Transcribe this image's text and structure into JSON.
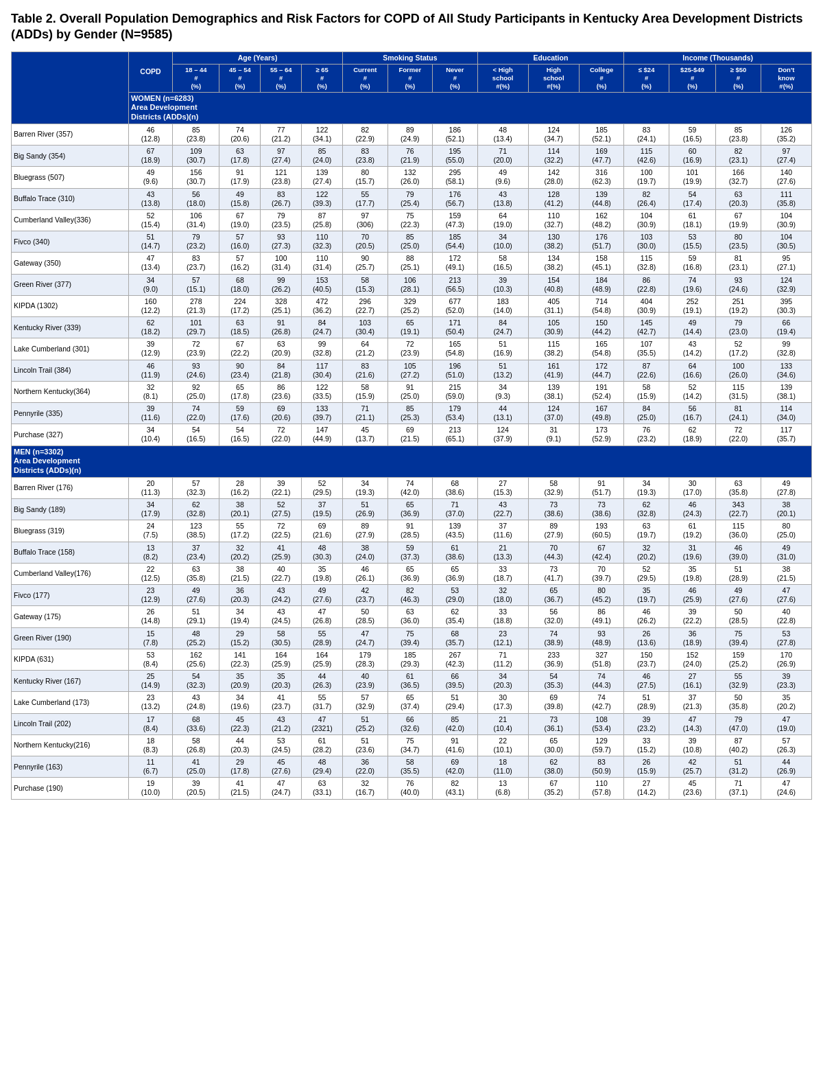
{
  "title": "Table 2.   Overall Population Demographics and Risk Factors for COPD of All Study Participants in Kentucky Area Development Districts (ADDs) by Gender (N=9585)",
  "headers": {
    "col1": "",
    "copd": "COPD",
    "age": "Age (Years)",
    "smoking": "Smoking Status",
    "education": "Education",
    "income": "Income (Thousands)"
  },
  "subheaders": {
    "col1_label": "WOMEN (n=6283)\nArea Development\nDistricts (ADDs)(n)",
    "copd_sub": "# (%)",
    "age1": "18 – 44 #  (%)",
    "age2": "45 – 54 # (%)",
    "age3": "55 – 64 # (%)",
    "age4": "≥ 65 # (%)",
    "sm1": "Current # (%)",
    "sm2": "Former # (%)",
    "sm3": "Never # (%)",
    "ed1": "< High school # #(%)",
    "ed2": "High school #(%)",
    "ed3": "College # (%)",
    "inc1": "≤ $24 # (%)",
    "inc2": "$25-$49 # (%)",
    "inc3": "≥ $50 # (%)",
    "inc4": "Don't know #(%)"
  },
  "women_rows": [
    {
      "name": "Barren River (357)",
      "copd": "46\n(12.8)",
      "a1": "85\n(23.8)",
      "a2": "74\n(20.6)",
      "a3": "77\n(21.2)",
      "a4": "122\n(34.1)",
      "s1": "82\n(22.9)",
      "s2": "89\n(24.9)",
      "s3": "186\n(52.1)",
      "e1": "48\n(13.4)",
      "e2": "124\n(34.7)",
      "e3": "185\n(52.1)",
      "i1": "83\n(24.1)",
      "i2": "59\n(16.5)",
      "i3": "85\n(23.8)",
      "i4": "126\n(35.2)"
    },
    {
      "name": "Big Sandy (354)",
      "copd": "67\n(18.9)",
      "a1": "109\n(30.7)",
      "a2": "63\n(17.8)",
      "a3": "97\n(27.4)",
      "a4": "85\n(24.0)",
      "s1": "83\n(23.8)",
      "s2": "76\n(21.9)",
      "s3": "195\n(55.0)",
      "e1": "71\n(20.0)",
      "e2": "114\n(32.2)",
      "e3": "169\n(47.7)",
      "i1": "115\n(42.6)",
      "i2": "60\n(16.9)",
      "i3": "82\n(23.1)",
      "i4": "97\n(27.4)"
    },
    {
      "name": "Bluegrass (507)",
      "copd": "49\n(9.6)",
      "a1": "156\n(30.7)",
      "a2": "91\n(17.9)",
      "a3": "121\n(23.8)",
      "a4": "139\n(27.4)",
      "s1": "80\n(15.7)",
      "s2": "132\n(26.0)",
      "s3": "295\n(58.1)",
      "e1": "49\n(9.6)",
      "e2": "142\n(28.0)",
      "e3": "316\n(62.3)",
      "i1": "100\n(19.7)",
      "i2": "101\n(19.9)",
      "i3": "166\n(32.7)",
      "i4": "140\n(27.6)"
    },
    {
      "name": "Buffalo Trace (310)",
      "copd": "43\n(13.8)",
      "a1": "56\n(18.0)",
      "a2": "49\n(15.8)",
      "a3": "83\n(26.7)",
      "a4": "122\n(39.3)",
      "s1": "55\n(17.7)",
      "s2": "79\n(25.4)",
      "s3": "176\n(56.7)",
      "e1": "43\n(13.8)",
      "e2": "128\n(41.2)",
      "e3": "139\n(44.8)",
      "i1": "82\n(26.4)",
      "i2": "54\n(17.4)",
      "i3": "63\n(20.3)",
      "i4": "111\n(35.8)"
    },
    {
      "name": "Cumberland Valley(336)",
      "copd": "52\n(15.4)",
      "a1": "106\n(31.4)",
      "a2": "67\n(19.0)",
      "a3": "79\n(23.5)",
      "a4": "87\n(25.8)",
      "s1": "97\n(306)",
      "s2": "75\n(22.3)",
      "s3": "159\n(47.3)",
      "e1": "64\n(19.0)",
      "e2": "110\n(32.7)",
      "e3": "162\n(48.2)",
      "i1": "104\n(30.9)",
      "i2": "61\n(18.1)",
      "i3": "67\n(19.9)",
      "i4": "104\n(30.9)"
    },
    {
      "name": "Fivco (340)",
      "copd": "51\n(14.7)",
      "a1": "79\n(23.2)",
      "a2": "57\n(16.0)",
      "a3": "93\n(27.3)",
      "a4": "110\n(32.3)",
      "s1": "70\n(20.5)",
      "s2": "85\n(25.0)",
      "s3": "185\n(54.4)",
      "e1": "34\n(10.0)",
      "e2": "130\n(38.2)",
      "e3": "176\n(51.7)",
      "i1": "103\n(30.0)",
      "i2": "53\n(15.5)",
      "i3": "80\n(23.5)",
      "i4": "104\n(30.5)"
    },
    {
      "name": "Gateway (350)",
      "copd": "47\n(13.4)",
      "a1": "83\n(23.7)",
      "a2": "57\n(16.2)",
      "a3": "100\n(31.4)",
      "a4": "110\n(31.4)",
      "s1": "90\n(25.7)",
      "s2": "88\n(25.1)",
      "s3": "172\n(49.1)",
      "e1": "58\n(16.5)",
      "e2": "134\n(38.2)",
      "e3": "158\n(45.1)",
      "i1": "115\n(32.8)",
      "i2": "59\n(16.8)",
      "i3": "81\n(23.1)",
      "i4": "95\n(27.1)"
    },
    {
      "name": "Green River (377)",
      "copd": "34\n(9.0)",
      "a1": "57\n(15.1)",
      "a2": "68\n(18.0)",
      "a3": "99\n(26.2)",
      "a4": "153\n(40.5)",
      "s1": "58\n(15.3)",
      "s2": "106\n(28.1)",
      "s3": "213\n(56.5)",
      "e1": "39\n(10.3)",
      "e2": "154\n(40.8)",
      "e3": "184\n(48.9)",
      "i1": "86\n(22.8)",
      "i2": "74\n(19.6)",
      "i3": "93\n(24.6)",
      "i4": "124\n(32.9)"
    },
    {
      "name": "KIPDA (1302)",
      "copd": "160\n(12.2)",
      "a1": "278\n(21.3)",
      "a2": "224\n(17.2)",
      "a3": "328\n(25.1)",
      "a4": "472\n(36.2)",
      "s1": "296\n(22.7)",
      "s2": "329\n(25.2)",
      "s3": "677\n(52.0)",
      "e1": "183\n(14.0)",
      "e2": "405\n(31.1)",
      "e3": "714\n(54.8)",
      "i1": "404\n(30.9)",
      "i2": "252\n(19.1)",
      "i3": "251\n(19.2)",
      "i4": "395\n(30.3)"
    },
    {
      "name": "Kentucky River (339)",
      "copd": "62\n(18.2)",
      "a1": "101\n(29.7)",
      "a2": "63\n(18.5)",
      "a3": "91\n(26.8)",
      "a4": "84\n(24.7)",
      "s1": "103\n(30.4)",
      "s2": "65\n(19.1)",
      "s3": "171\n(50.4)",
      "e1": "84\n(24.7)",
      "e2": "105\n(30.9)",
      "e3": "150\n(44.2)",
      "i1": "145\n(42.7)",
      "i2": "49\n(14.4)",
      "i3": "79\n(23.0)",
      "i4": "66\n(19.4)"
    },
    {
      "name": "Lake Cumberland (301)",
      "copd": "39\n(12.9)",
      "a1": "72\n(23.9)",
      "a2": "67\n(22.2)",
      "a3": "63\n(20.9)",
      "a4": "99\n(32.8)",
      "s1": "64\n(21.2)",
      "s2": "72\n(23.9)",
      "s3": "165\n(54.8)",
      "e1": "51\n(16.9)",
      "e2": "115\n(38.2)",
      "e3": "165\n(54.8)",
      "i1": "107\n(35.5)",
      "i2": "43\n(14.2)",
      "i3": "52\n(17.2)",
      "i4": "99\n(32.8)"
    },
    {
      "name": "Lincoln Trail (384)",
      "copd": "46\n(11.9)",
      "a1": "93\n(24.6)",
      "a2": "90\n(23.4)",
      "a3": "84\n(21.8)",
      "a4": "117\n(30.4)",
      "s1": "83\n(21.6)",
      "s2": "105\n(27.2)",
      "s3": "196\n(51.0)",
      "e1": "51\n(13.2)",
      "e2": "161\n(41.9)",
      "e3": "172\n(44.7)",
      "i1": "87\n(22.6)",
      "i2": "64\n(16.6)",
      "i3": "100\n(26.0)",
      "i4": "133\n(34.6)"
    },
    {
      "name": "Northern Kentucky(364)",
      "copd": "32\n(8.1)",
      "a1": "92\n(25.0)",
      "a2": "65\n(17.8)",
      "a3": "86\n(23.6)",
      "a4": "122\n(33.5)",
      "s1": "58\n(15.9)",
      "s2": "91\n(25.0)",
      "s3": "215\n(59.0)",
      "e1": "34\n(9.3)",
      "e2": "139\n(38.1)",
      "e3": "191\n(52.4)",
      "i1": "58\n(15.9)",
      "i2": "52\n(14.2)",
      "i3": "115\n(31.5)",
      "i4": "139\n(38.1)"
    },
    {
      "name": "Pennyrile (335)",
      "copd": "39\n(11.6)",
      "a1": "74\n(22.0)",
      "a2": "59\n(17.6)",
      "a3": "69\n(20.6)",
      "a4": "133\n(39.7)",
      "s1": "71\n(21.1)",
      "s2": "85\n(25.3)",
      "s3": "179\n(53.4)",
      "e1": "44\n(13.1)",
      "e2": "124\n(37.0)",
      "e3": "167\n(49.8)",
      "i1": "84\n(25.0)",
      "i2": "56\n(16.7)",
      "i3": "81\n(24.1)",
      "i4": "114\n(34.0)"
    },
    {
      "name": "Purchase (327)",
      "copd": "34\n(10.4)",
      "a1": "54\n(16.5)",
      "a2": "54\n(16.5)",
      "a3": "72\n(22.0)",
      "a4": "147\n(44.9)",
      "s1": "45\n(13.7)",
      "s2": "69\n(21.5)",
      "s3": "213\n(65.1)",
      "e1": "124\n(37.9)",
      "e2": "31\n(9.1)",
      "e3": "173\n(52.9)",
      "i1": "76\n(23.2)",
      "i2": "62\n(18.9)",
      "i3": "72\n(22.0)",
      "i4": "117\n(35.7)"
    }
  ],
  "men_rows": [
    {
      "name": "Barren River (176)",
      "copd": "20\n(11.3)",
      "a1": "57\n(32.3)",
      "a2": "28\n(16.2)",
      "a3": "39\n(22.1)",
      "a4": "52\n(29.5)",
      "s1": "34\n(19.3)",
      "s2": "74\n(42.0)",
      "s3": "68\n(38.6)",
      "e1": "27\n(15.3)",
      "e2": "58\n(32.9)",
      "e3": "91\n(51.7)",
      "i1": "34\n(19.3)",
      "i2": "30\n(17.0)",
      "i3": "63\n(35.8)",
      "i4": "49\n(27.8)"
    },
    {
      "name": "Big Sandy (189)",
      "copd": "34\n(17.9)",
      "a1": "62\n(32.8)",
      "a2": "38\n(20.1)",
      "a3": "52\n(27.5)",
      "a4": "37\n(19.5)",
      "s1": "51\n(26.9)",
      "s2": "65\n(36.9)",
      "s3": "71\n(37.0)",
      "e1": "43\n(22.7)",
      "e2": "73\n(38.6)",
      "e3": "73\n(38.6)",
      "i1": "62\n(32.8)",
      "i2": "46\n(24.3)",
      "i3": "343\n(22.7)",
      "i4": "38\n(20.1)"
    },
    {
      "name": "Bluegrass (319)",
      "copd": "24\n(7.5)",
      "a1": "123\n(38.5)",
      "a2": "55\n(17.2)",
      "a3": "72\n(22.5)",
      "a4": "69\n(21.6)",
      "s1": "89\n(27.9)",
      "s2": "91\n(28.5)",
      "s3": "139\n(43.5)",
      "e1": "37\n(11.6)",
      "e2": "89\n(27.9)",
      "e3": "193\n(60.5)",
      "i1": "63\n(19.7)",
      "i2": "61\n(19.2)",
      "i3": "115\n(36.0)",
      "i4": "80\n(25.0)"
    },
    {
      "name": "Buffalo Trace (158)",
      "copd": "13\n(8.2)",
      "a1": "37\n(23.4)",
      "a2": "32\n(20.2)",
      "a3": "41\n(25.9)",
      "a4": "48\n(30.3)",
      "s1": "38\n(24.0)",
      "s2": "59\n(37.3)",
      "s3": "61\n(38.6)",
      "e1": "21\n(13.3)",
      "e2": "70\n(44.3)",
      "e3": "67\n(42.4)",
      "i1": "32\n(20.2)",
      "i2": "31\n(19.6)",
      "i3": "46\n(39.0)",
      "i4": "49\n(31.0)"
    },
    {
      "name": "Cumberland Valley(176)",
      "copd": "22\n(12.5)",
      "a1": "63\n(35.8)",
      "a2": "38\n(21.5)",
      "a3": "40\n(22.7)",
      "a4": "35\n(19.8)",
      "s1": "46\n(26.1)",
      "s2": "65\n(36.9)",
      "s3": "65\n(36.9)",
      "e1": "33\n(18.7)",
      "e2": "73\n(41.7)",
      "e3": "70\n(39.7)",
      "i1": "52\n(29.5)",
      "i2": "35\n(19.8)",
      "i3": "51\n(28.9)",
      "i4": "38\n(21.5)"
    },
    {
      "name": "Fivco (177)",
      "copd": "23\n(12.9)",
      "a1": "49\n(27.6)",
      "a2": "36\n(20.3)",
      "a3": "43\n(24.2)",
      "a4": "49\n(27.6)",
      "s1": "42\n(23.7)",
      "s2": "82\n(46.3)",
      "s3": "53\n(29.0)",
      "e1": "32\n(18.0)",
      "e2": "65\n(36.7)",
      "e3": "80\n(45.2)",
      "i1": "35\n(19.7)",
      "i2": "46\n(25.9)",
      "i3": "49\n(27.6)",
      "i4": "47\n(27.6)"
    },
    {
      "name": "Gateway (175)",
      "copd": "26\n(14.8)",
      "a1": "51\n(29.1)",
      "a2": "34\n(19.4)",
      "a3": "43\n(24.5)",
      "a4": "47\n(26.8)",
      "s1": "50\n(28.5)",
      "s2": "63\n(36.0)",
      "s3": "62\n(35.4)",
      "e1": "33\n(18.8)",
      "e2": "56\n(32.0)",
      "e3": "86\n(49.1)",
      "i1": "46\n(26.2)",
      "i2": "39\n(22.2)",
      "i3": "50\n(28.5)",
      "i4": "40\n(22.8)"
    },
    {
      "name": "Green River (190)",
      "copd": "15\n(7.8)",
      "a1": "48\n(25.2)",
      "a2": "29\n(15.2)",
      "a3": "58\n(30.5)",
      "a4": "55\n(28.9)",
      "s1": "47\n(24.7)",
      "s2": "75\n(39.4)",
      "s3": "68\n(35.7)",
      "e1": "23\n(12.1)",
      "e2": "74\n(38.9)",
      "e3": "93\n(48.9)",
      "i1": "26\n(13.6)",
      "i2": "36\n(18.9)",
      "i3": "75\n(39.4)",
      "i4": "53\n(27.8)"
    },
    {
      "name": "KIPDA (631)",
      "copd": "53\n(8.4)",
      "a1": "162\n(25.6)",
      "a2": "141\n(22.3)",
      "a3": "164\n(25.9)",
      "a4": "164\n(25.9)",
      "s1": "179\n(28.3)",
      "s2": "185\n(29.3)",
      "s3": "267\n(42.3)",
      "e1": "71\n(11.2)",
      "e2": "233\n(36.9)",
      "e3": "327\n(51.8)",
      "i1": "150\n(23.7)",
      "i2": "152\n(24.0)",
      "i3": "159\n(25.2)",
      "i4": "170\n(26.9)"
    },
    {
      "name": "Kentucky River (167)",
      "copd": "25\n(14.9)",
      "a1": "54\n(32.3)",
      "a2": "35\n(20.9)",
      "a3": "35\n(20.3)",
      "a4": "44\n(26.3)",
      "s1": "40\n(23.9)",
      "s2": "61\n(36.5)",
      "s3": "66\n(39.5)",
      "e1": "34\n(20.3)",
      "e2": "54\n(35.3)",
      "e3": "74\n(44.3)",
      "i1": "46\n(27.5)",
      "i2": "27\n(16.1)",
      "i3": "55\n(32.9)",
      "i4": "39\n(23.3)"
    },
    {
      "name": "Lake Cumberland (173)",
      "copd": "23\n(13.2)",
      "a1": "43\n(24.8)",
      "a2": "34\n(19.6)",
      "a3": "41\n(23.7)",
      "a4": "55\n(31.7)",
      "s1": "57\n(32.9)",
      "s2": "65\n(37.4)",
      "s3": "51\n(29.4)",
      "e1": "30\n(17.3)",
      "e2": "69\n(39.8)",
      "e3": "74\n(42.7)",
      "i1": "51\n(28.9)",
      "i2": "37\n(21.3)",
      "i3": "50\n(35.8)",
      "i4": "35\n(20.2)"
    },
    {
      "name": "Lincoln Trail (202)",
      "copd": "17\n(8.4)",
      "a1": "68\n(33.6)",
      "a2": "45\n(22.3)",
      "a3": "43\n(21.2)",
      "a4": "47\n(2321)",
      "s1": "51\n(25.2)",
      "s2": "66\n(32.6)",
      "s3": "85\n(42.0)",
      "e1": "21\n(10.4)",
      "e2": "73\n(36.1)",
      "e3": "108\n(53.4)",
      "i1": "39\n(23.2)",
      "i2": "47\n(14.3)",
      "i3": "79\n(47.0)",
      "i4": "47\n(19.0)"
    },
    {
      "name": "Northern Kentucky(216)",
      "copd": "18\n(8.3)",
      "a1": "58\n(26.8)",
      "a2": "44\n(20.3)",
      "a3": "53\n(24.5)",
      "a4": "61\n(28.2)",
      "s1": "51\n(23.6)",
      "s2": "75\n(34.7)",
      "s3": "91\n(41.6)",
      "e1": "22\n(10.1)",
      "e2": "65\n(30.0)",
      "e3": "129\n(59.7)",
      "i1": "33\n(15.2)",
      "i2": "39\n(10.8)",
      "i3": "87\n(40.2)",
      "i4": "57\n(26.3)"
    },
    {
      "name": "Pennyrile (163)",
      "copd": "11\n(6.7)",
      "a1": "41\n(25.0)",
      "a2": "29\n(17.8)",
      "a3": "45\n(27.6)",
      "a4": "48\n(29.4)",
      "s1": "36\n(22.0)",
      "s2": "58\n(35.5)",
      "s3": "69\n(42.0)",
      "e1": "18\n(11.0)",
      "e2": "62\n(38.0)",
      "e3": "83\n(50.9)",
      "i1": "26\n(15.9)",
      "i2": "42\n(25.7)",
      "i3": "51\n(31.2)",
      "i4": "44\n(26.9)"
    },
    {
      "name": "Purchase (190)",
      "copd": "19\n(10.0)",
      "a1": "39\n(20.5)",
      "a2": "41\n(21.5)",
      "a3": "47\n(24.7)",
      "a4": "63\n(33.1)",
      "s1": "32\n(16.7)",
      "s2": "76\n(40.0)",
      "s3": "82\n(43.1)",
      "e1": "13\n(6.8)",
      "e2": "67\n(35.2)",
      "e3": "110\n(57.8)",
      "i1": "27\n(14.2)",
      "i2": "45\n(23.6)",
      "i3": "71\n(37.1)",
      "i4": "47\n(24.6)"
    }
  ]
}
